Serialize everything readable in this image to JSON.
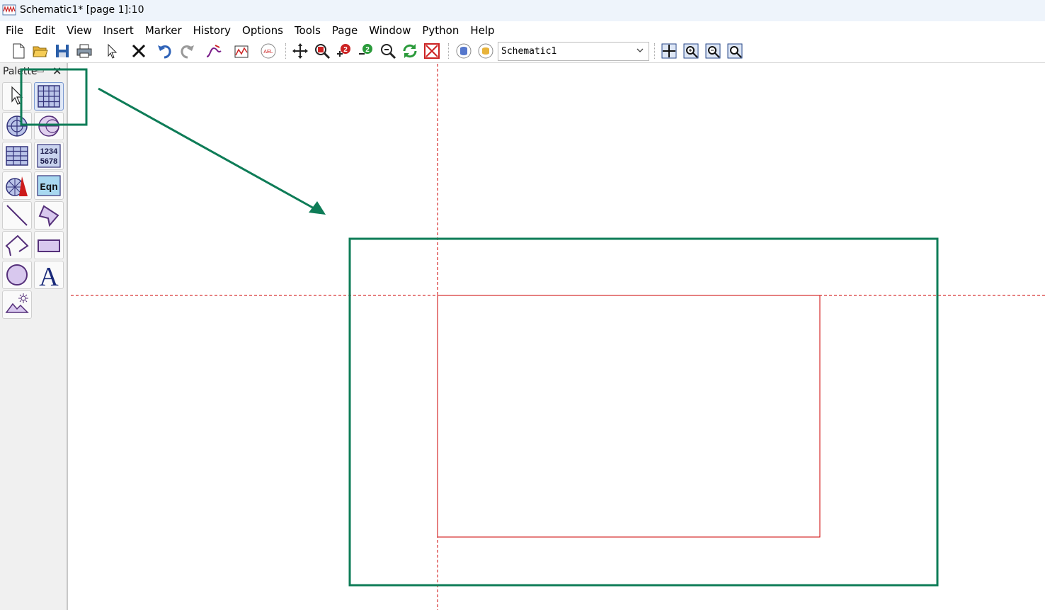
{
  "window": {
    "title": "Schematic1* [page 1]:10"
  },
  "menu": [
    "File",
    "Edit",
    "View",
    "Insert",
    "Marker",
    "History",
    "Options",
    "Tools",
    "Page",
    "Window",
    "Python",
    "Help"
  ],
  "toolbar": {
    "buttons": [
      "new-icon",
      "open-icon",
      "save-icon",
      "print-icon",
      "pointer-icon",
      "delete-icon",
      "undo-icon",
      "redo-icon",
      "trace-icon",
      "plot-icon",
      "ael-icon",
      "pan-icon",
      "zoom-area-icon",
      "zoom-in-icon",
      "zoom-out-icon",
      "zoom-icon",
      "refresh-icon",
      "stop-icon",
      "database-icon",
      "dataset-icon",
      "view-all-icon",
      "zoom-in-page-icon",
      "zoom-out-page-icon",
      "zoom-fit-icon"
    ],
    "ael_label": "AEL",
    "dataset_value": "Schematic1"
  },
  "palette": {
    "title": "Palette",
    "close": "×",
    "items": [
      "pointer-icon",
      "rectangular-plot-icon",
      "polar-plot-icon",
      "smith-chart-icon",
      "list-table-icon",
      "stack-icon",
      "antenna-plot-icon",
      "equation-icon",
      "line-icon",
      "polygon-icon",
      "polyline-icon",
      "rectangle-icon",
      "circle-icon",
      "text-icon",
      "image-icon"
    ],
    "stack_label_1": "1234",
    "stack_label_2": "5678",
    "eqn_label": "Eqn",
    "text_label": "A"
  },
  "annotation": {
    "color": "#0e7c57"
  },
  "page_border_color": "#cc0000"
}
